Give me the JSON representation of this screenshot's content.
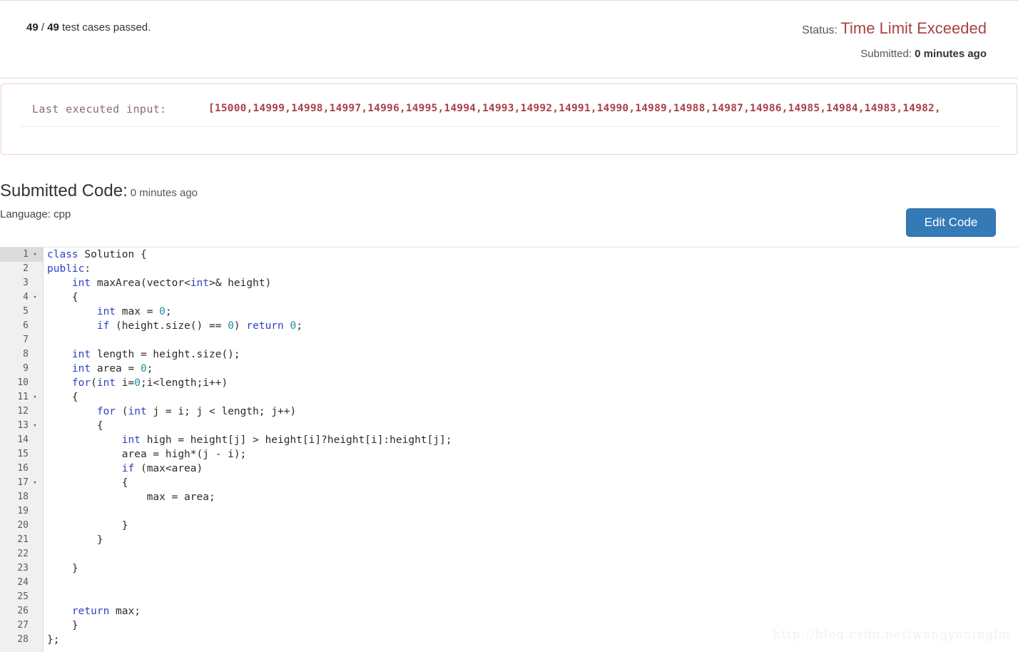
{
  "result": {
    "testcases_passed": "49",
    "testcases_total": "49",
    "testcases_suffix": "test cases passed.",
    "status_label": "Status:",
    "status_value": "Time Limit Exceeded",
    "status_color": "#a94442",
    "submitted_label": "Submitted:",
    "submitted_value": "0 minutes ago"
  },
  "last_executed_input": {
    "label": "Last executed input:",
    "value": "[15000,14999,14998,14997,14996,14995,14994,14993,14992,14991,14990,14989,14988,14987,14986,14985,14984,14983,14982,",
    "value_color": "#a9414a"
  },
  "submitted_code": {
    "title": "Submitted Code:",
    "time": "0 minutes ago",
    "language_line": "Language: cpp",
    "edit_button": "Edit Code",
    "edit_button_color": "#337ab7"
  },
  "editor": {
    "lines": [
      {
        "n": "1",
        "fold": true,
        "active": true,
        "tokens": [
          {
            "t": "class",
            "c": "kw"
          },
          {
            "t": " Solution {",
            "c": ""
          }
        ]
      },
      {
        "n": "2",
        "fold": false,
        "active": false,
        "tokens": [
          {
            "t": "public",
            "c": "kw"
          },
          {
            "t": ":",
            "c": ""
          }
        ]
      },
      {
        "n": "3",
        "fold": false,
        "active": false,
        "tokens": [
          {
            "t": "    ",
            "c": ""
          },
          {
            "t": "int",
            "c": "kw"
          },
          {
            "t": " maxArea(vector<",
            "c": ""
          },
          {
            "t": "int",
            "c": "kw"
          },
          {
            "t": ">& height)",
            "c": ""
          }
        ]
      },
      {
        "n": "4",
        "fold": true,
        "active": false,
        "tokens": [
          {
            "t": "    {",
            "c": ""
          }
        ]
      },
      {
        "n": "5",
        "fold": false,
        "active": false,
        "tokens": [
          {
            "t": "        ",
            "c": ""
          },
          {
            "t": "int",
            "c": "kw"
          },
          {
            "t": " max = ",
            "c": ""
          },
          {
            "t": "0",
            "c": "num"
          },
          {
            "t": ";",
            "c": ""
          }
        ]
      },
      {
        "n": "6",
        "fold": false,
        "active": false,
        "tokens": [
          {
            "t": "        ",
            "c": ""
          },
          {
            "t": "if",
            "c": "kw"
          },
          {
            "t": " (height.size() == ",
            "c": ""
          },
          {
            "t": "0",
            "c": "num"
          },
          {
            "t": ") ",
            "c": ""
          },
          {
            "t": "return",
            "c": "kw"
          },
          {
            "t": " ",
            "c": ""
          },
          {
            "t": "0",
            "c": "num"
          },
          {
            "t": ";",
            "c": ""
          }
        ]
      },
      {
        "n": "7",
        "fold": false,
        "active": false,
        "tokens": [
          {
            "t": "",
            "c": ""
          }
        ]
      },
      {
        "n": "8",
        "fold": false,
        "active": false,
        "tokens": [
          {
            "t": "    ",
            "c": ""
          },
          {
            "t": "int",
            "c": "kw"
          },
          {
            "t": " length = height.size();",
            "c": ""
          }
        ]
      },
      {
        "n": "9",
        "fold": false,
        "active": false,
        "tokens": [
          {
            "t": "    ",
            "c": ""
          },
          {
            "t": "int",
            "c": "kw"
          },
          {
            "t": " area = ",
            "c": ""
          },
          {
            "t": "0",
            "c": "num"
          },
          {
            "t": ";",
            "c": ""
          }
        ]
      },
      {
        "n": "10",
        "fold": false,
        "active": false,
        "tokens": [
          {
            "t": "    ",
            "c": ""
          },
          {
            "t": "for",
            "c": "kw"
          },
          {
            "t": "(",
            "c": ""
          },
          {
            "t": "int",
            "c": "kw"
          },
          {
            "t": " i=",
            "c": ""
          },
          {
            "t": "0",
            "c": "num"
          },
          {
            "t": ";i<length;i++)",
            "c": ""
          }
        ]
      },
      {
        "n": "11",
        "fold": true,
        "active": false,
        "tokens": [
          {
            "t": "    {",
            "c": ""
          }
        ]
      },
      {
        "n": "12",
        "fold": false,
        "active": false,
        "tokens": [
          {
            "t": "        ",
            "c": ""
          },
          {
            "t": "for",
            "c": "kw"
          },
          {
            "t": " (",
            "c": ""
          },
          {
            "t": "int",
            "c": "kw"
          },
          {
            "t": " j = i; j < length; j++)",
            "c": ""
          }
        ]
      },
      {
        "n": "13",
        "fold": true,
        "active": false,
        "tokens": [
          {
            "t": "        {",
            "c": ""
          }
        ]
      },
      {
        "n": "14",
        "fold": false,
        "active": false,
        "tokens": [
          {
            "t": "            ",
            "c": ""
          },
          {
            "t": "int",
            "c": "kw"
          },
          {
            "t": " high = height[j] > height[i]?height[i]:height[j];",
            "c": ""
          }
        ]
      },
      {
        "n": "15",
        "fold": false,
        "active": false,
        "tokens": [
          {
            "t": "            area = high*(j - i);",
            "c": ""
          }
        ]
      },
      {
        "n": "16",
        "fold": false,
        "active": false,
        "tokens": [
          {
            "t": "            ",
            "c": ""
          },
          {
            "t": "if",
            "c": "kw"
          },
          {
            "t": " (max<area)",
            "c": ""
          }
        ]
      },
      {
        "n": "17",
        "fold": true,
        "active": false,
        "tokens": [
          {
            "t": "            {",
            "c": ""
          }
        ]
      },
      {
        "n": "18",
        "fold": false,
        "active": false,
        "tokens": [
          {
            "t": "                max = area;",
            "c": ""
          }
        ]
      },
      {
        "n": "19",
        "fold": false,
        "active": false,
        "tokens": [
          {
            "t": "",
            "c": ""
          }
        ]
      },
      {
        "n": "20",
        "fold": false,
        "active": false,
        "tokens": [
          {
            "t": "            }",
            "c": ""
          }
        ]
      },
      {
        "n": "21",
        "fold": false,
        "active": false,
        "tokens": [
          {
            "t": "        }",
            "c": ""
          }
        ]
      },
      {
        "n": "22",
        "fold": false,
        "active": false,
        "tokens": [
          {
            "t": "",
            "c": ""
          }
        ]
      },
      {
        "n": "23",
        "fold": false,
        "active": false,
        "tokens": [
          {
            "t": "    }",
            "c": ""
          }
        ]
      },
      {
        "n": "24",
        "fold": false,
        "active": false,
        "tokens": [
          {
            "t": "",
            "c": ""
          }
        ]
      },
      {
        "n": "25",
        "fold": false,
        "active": false,
        "tokens": [
          {
            "t": "",
            "c": ""
          }
        ]
      },
      {
        "n": "26",
        "fold": false,
        "active": false,
        "tokens": [
          {
            "t": "    ",
            "c": ""
          },
          {
            "t": "return",
            "c": "kw"
          },
          {
            "t": " max;",
            "c": ""
          }
        ]
      },
      {
        "n": "27",
        "fold": false,
        "active": false,
        "tokens": [
          {
            "t": "    }",
            "c": ""
          }
        ]
      },
      {
        "n": "28",
        "fold": false,
        "active": false,
        "tokens": [
          {
            "t": "};",
            "c": ""
          }
        ]
      }
    ],
    "fold_glyph": "▾"
  },
  "watermark": "http://blog.csdn.net/wangyaninglm"
}
